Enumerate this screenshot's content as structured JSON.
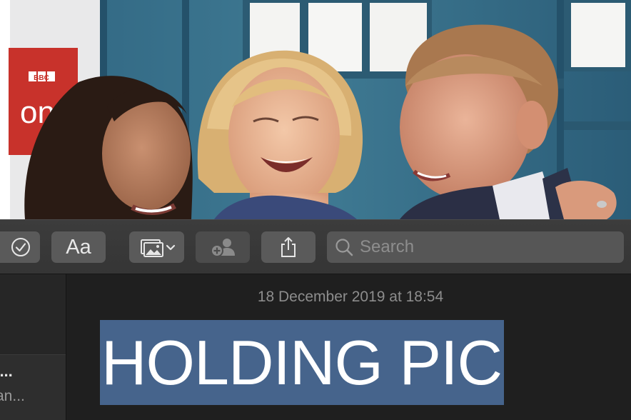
{
  "photo": {
    "description_icon": "photo-image",
    "sign_brand": "BBC",
    "sign_channel": "one"
  },
  "toolbar": {
    "checklist_icon": "checkmark-circle-icon",
    "format_label": "Aa",
    "media_icon": "photo-browser-icon",
    "collaborate_icon": "add-people-icon",
    "share_icon": "share-icon",
    "search_icon": "search-icon",
    "search_placeholder": "Search"
  },
  "sidebar": {
    "note_title": "n...",
    "note_snippet": "an..."
  },
  "note": {
    "date": "18 December 2019 at 18:54",
    "heading": "HOLDING PIC"
  },
  "colors": {
    "selection": "#46648c",
    "toolbar": "#3a3a3a",
    "button": "#5a5a5a",
    "editor_bg": "#1f1f1f"
  }
}
